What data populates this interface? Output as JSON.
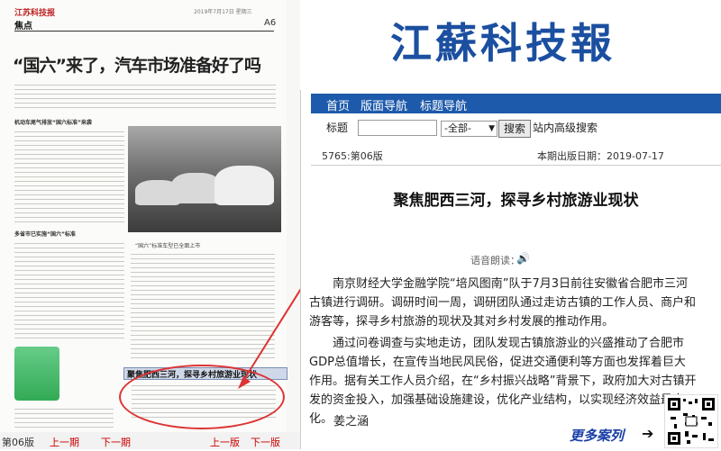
{
  "paper": {
    "masthead": "江苏科技报",
    "date_line": "2019年7月17日 星期三",
    "section": "焦点",
    "page_number": "A6",
    "headline": "“国六”来了，汽车市场准备好了吗",
    "subhead1": "机动车尾气排放“国六标准”来袭",
    "subhead2": "多省市已实施“国六”标准",
    "photo_caption": "“国六”标准车型已全面上市",
    "article_title": "聚焦肥西三河，探寻乡村旅游业现状",
    "nav": {
      "edition": "第06版",
      "prev_issue": "上一期",
      "next_issue": "下一期",
      "prev_page": "上一版",
      "next_page": "下一版"
    }
  },
  "site": {
    "title": "江蘇科技報",
    "nav": [
      "首页",
      "版面导航",
      "标题导航"
    ],
    "search": {
      "label": "标题",
      "select_value": "-全部-",
      "button": "搜索",
      "advanced": "站内高级搜索"
    }
  },
  "article": {
    "issue": "5765:第06版",
    "date_label": "本期出版日期：2019-07-17",
    "title": "聚焦肥西三河，探寻乡村旅游业现状",
    "audio_label": "语音朗读：",
    "paragraphs": [
      "南京财经大学金融学院“培风图南”队于7月3日前往安徽省合肥市三河古镇进行调研。调研时间一周，调研团队通过走访古镇的工作人员、商户和游客等，探寻乡村旅游的现状及其对乡村发展的推动作用。",
      "通过问卷调查与实地走访，团队发现古镇旅游业的兴盛推动了合肥市GDP总值增长，在宣传当地民风民俗，促进交通便利等方面也发挥着巨大作用。据有关工作人员介绍，在“乡村振兴战略”背景下，政府加大对古镇开发的资金投入，加强基础设施建设，优化产业结构，以实现经济效益最大化。"
    ],
    "author": "姜之涵"
  },
  "more_cases": "更多案列"
}
